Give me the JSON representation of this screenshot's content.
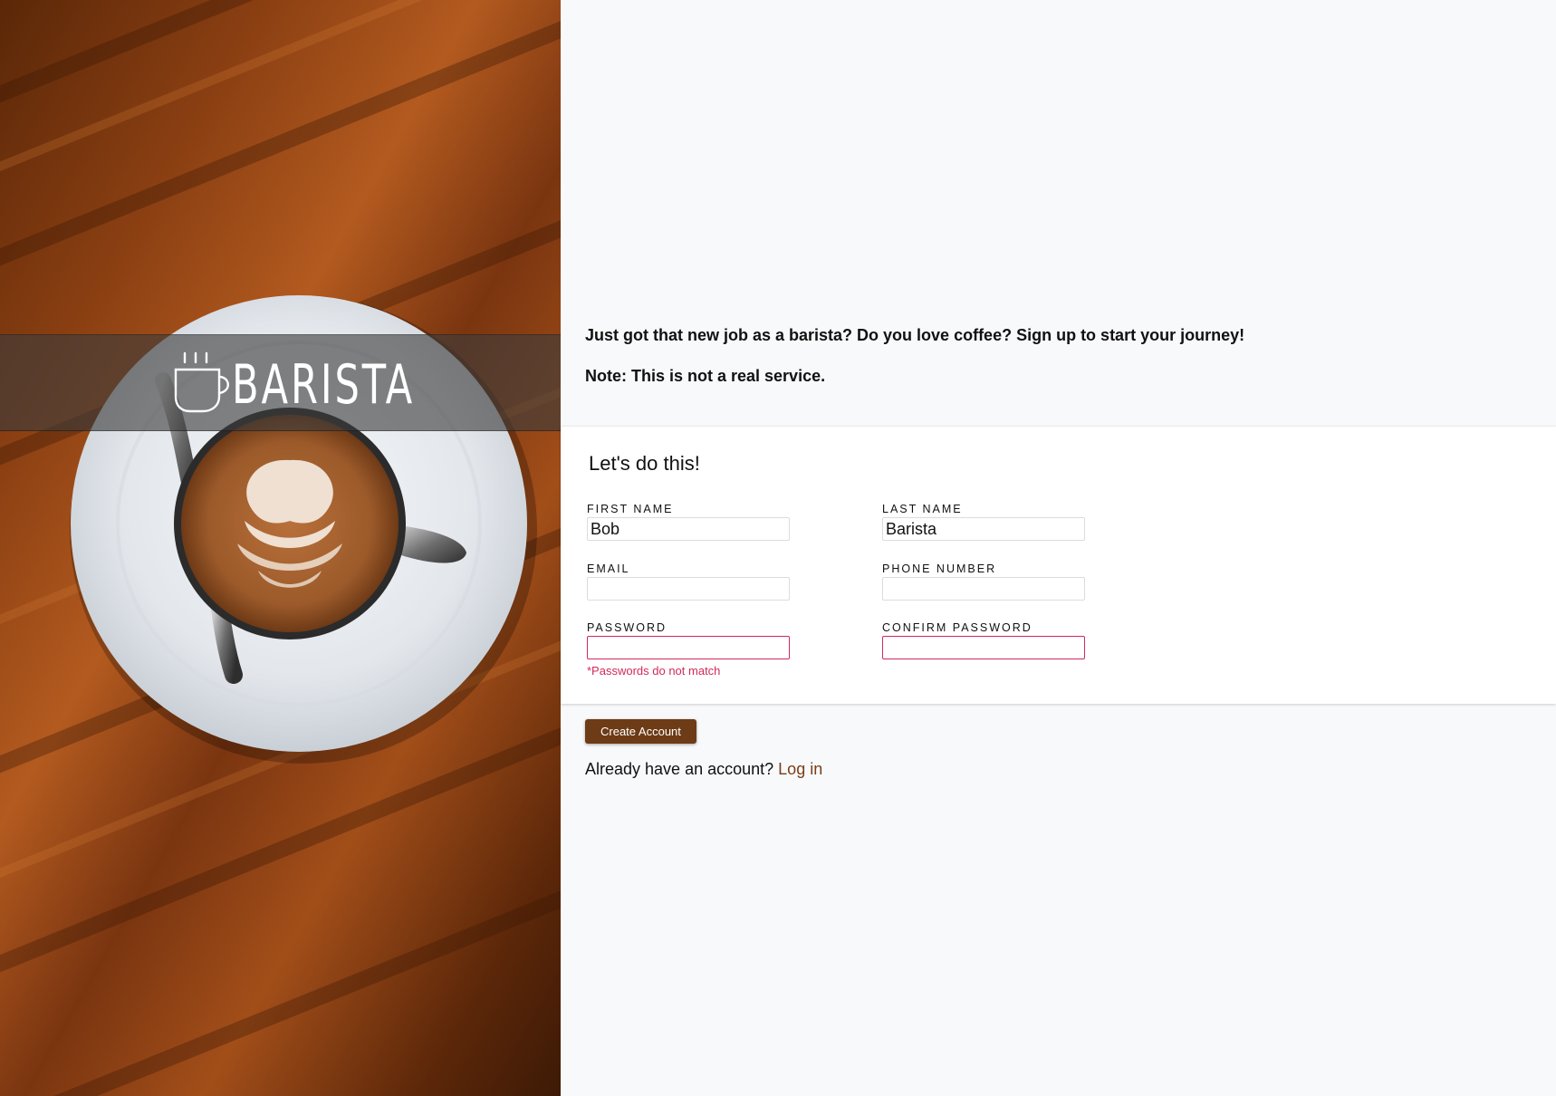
{
  "brand": {
    "name": "BARISTA",
    "logo_icon": "coffee-cup-icon"
  },
  "intro": {
    "tagline": "Just got that new job as a barista? Do you love coffee? Sign up to start your journey!",
    "note": "Note: This is not a real service."
  },
  "form": {
    "title": "Let's do this!",
    "first_name": {
      "label": "FIRST NAME",
      "value": "Bob",
      "placeholder": ""
    },
    "last_name": {
      "label": "LAST NAME",
      "value": "Barista",
      "placeholder": ""
    },
    "email": {
      "label": "EMAIL",
      "value": "",
      "placeholder": ""
    },
    "phone": {
      "label": "PHONE NUMBER",
      "value": "",
      "placeholder": ""
    },
    "password": {
      "label": "PASSWORD",
      "value": "",
      "placeholder": ""
    },
    "confirm_password": {
      "label": "CONFIRM PASSWORD",
      "value": "",
      "placeholder": ""
    },
    "password_error": "*Passwords do not match"
  },
  "actions": {
    "create_account_label": "Create Account",
    "login_prompt": "Already have an account?",
    "login_link": "Log in"
  },
  "colors": {
    "accent_brown": "#6d3b16",
    "link_brown": "#7a3d17",
    "error": "#d2295a",
    "page_bg": "#f8f9fb"
  }
}
